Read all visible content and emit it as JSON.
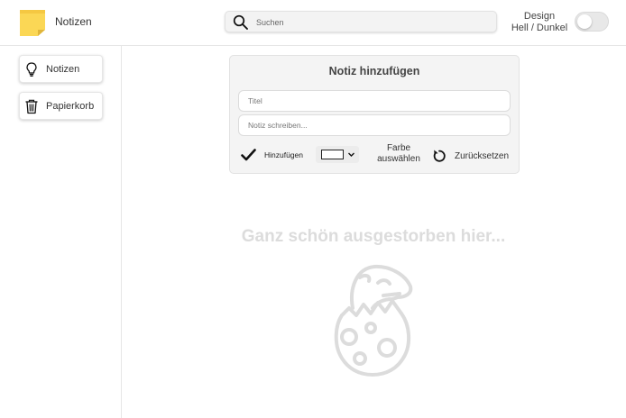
{
  "header": {
    "app_title": "Notizen",
    "logo_icon": "sticky-note-icon",
    "search_placeholder": "Suchen",
    "search_icon": "search-icon",
    "theme_label_line1": "Design",
    "theme_label_line2": "Hell / Dunkel",
    "theme_dark_enabled": false
  },
  "sidebar": {
    "items": [
      {
        "label": "Notizen",
        "icon": "lightbulb-icon"
      },
      {
        "label": "Papierkorb",
        "icon": "trash-icon"
      }
    ]
  },
  "note_form": {
    "heading": "Notiz hinzufügen",
    "title_placeholder": "Titel",
    "body_placeholder": "Notiz schreiben...",
    "add_label": "Hinzufügen",
    "color_label_line1": "Farbe",
    "color_label_line2": "auswählen",
    "selected_color": "#ffffff",
    "reset_label": "Zurücksetzen"
  },
  "empty_state": {
    "message": "Ganz schön ausgestorben hier...",
    "illustration": "dinosaur-egg-icon"
  },
  "colors": {
    "accent_logo": "#f5c842",
    "empty_state_gray": "#dcdcdc"
  }
}
